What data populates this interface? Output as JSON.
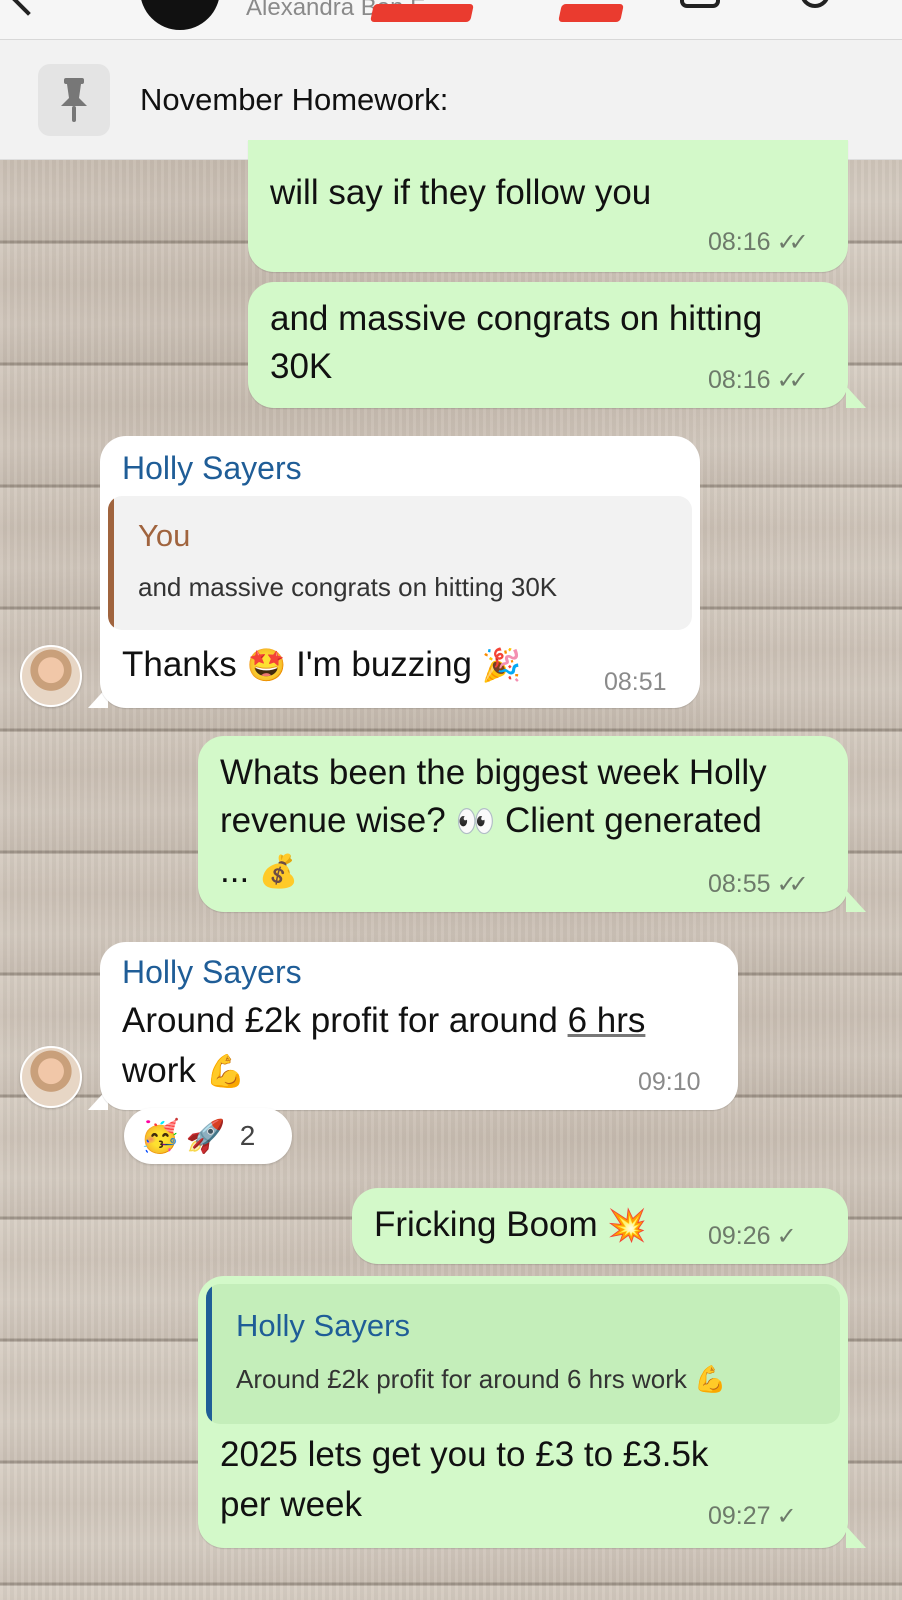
{
  "header": {
    "members": "Alexandra          Ben F         ."
  },
  "pinned": {
    "text": "November Homework:"
  },
  "messages": [
    {
      "id": "m1",
      "direction": "out",
      "text": "will say if they follow you",
      "time": "08:16",
      "status": "read"
    },
    {
      "id": "m2",
      "direction": "out",
      "line1": "and massive congrats on hitting",
      "line2": "30K",
      "time": "08:16",
      "status": "read"
    },
    {
      "id": "m3",
      "direction": "in",
      "sender": "Holly Sayers",
      "reply_name": "You",
      "reply_text": "and massive congrats on hitting 30K",
      "text_a": "Thanks",
      "emoji_a": "🤩",
      "text_b": "I'm buzzing",
      "emoji_b": "🎉",
      "time": "08:51"
    },
    {
      "id": "m4",
      "direction": "out",
      "line1": "Whats been the biggest week Holly",
      "line2_a": "revenue wise?",
      "emoji_eyes": "👀",
      "line2_b": "Client generated",
      "line3": "...",
      "emoji_money": "💰",
      "time": "08:55",
      "status": "read"
    },
    {
      "id": "m5",
      "direction": "in",
      "sender": "Holly Sayers",
      "line1_a": "Around £2k profit for around ",
      "line1_b": "6 hrs",
      "line2": "work",
      "emoji_muscle": "💪",
      "time": "09:10",
      "reactions": [
        "🥳",
        "🚀"
      ],
      "reaction_count": "2"
    },
    {
      "id": "m6",
      "direction": "out",
      "text": "Fricking Boom",
      "emoji": "💥",
      "time": "09:26",
      "status": "sent"
    },
    {
      "id": "m7",
      "direction": "out",
      "reply_name": "Holly Sayers",
      "reply_text": "Around £2k profit for around 6 hrs work",
      "reply_emoji": "💪",
      "line1": "2025 lets get you to £3 to £3.5k",
      "line2": "per week",
      "time": "09:27",
      "status": "sent"
    }
  ],
  "colors": {
    "outgoing_bubble": "#d3f9c9",
    "incoming_bubble": "#ffffff",
    "sender_name": "#1f5d97",
    "reply_you": "#a0643e",
    "redaction": "#ea3b2f"
  },
  "icons": {
    "pin": "pin-icon",
    "read": "double-check-icon",
    "sent": "single-check-icon"
  }
}
